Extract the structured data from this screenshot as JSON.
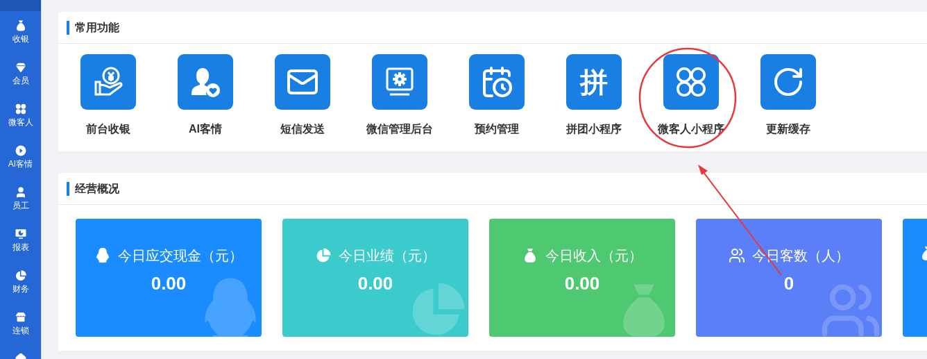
{
  "sidebar": {
    "items": [
      {
        "label": "收银"
      },
      {
        "label": "会员"
      },
      {
        "label": "微客人"
      },
      {
        "label": "AI客情"
      },
      {
        "label": "员工"
      },
      {
        "label": "报表"
      },
      {
        "label": "财务"
      },
      {
        "label": "连锁"
      }
    ]
  },
  "shortcuts": {
    "title": "常用功能",
    "items": [
      {
        "label": "前台收银"
      },
      {
        "label": "AI客情"
      },
      {
        "label": "短信发送"
      },
      {
        "label": "微信管理后台"
      },
      {
        "label": "预约管理"
      },
      {
        "label": "拼团小程序",
        "glyph": "拼"
      },
      {
        "label": "微客人小程序"
      },
      {
        "label": "更新缓存"
      }
    ]
  },
  "overview": {
    "title": "经营概况",
    "cards": [
      {
        "title": "今日应交现金（元）",
        "value": "0.00",
        "color": "#1a8cff"
      },
      {
        "title": "今日业绩（元）",
        "value": "0.00",
        "color": "#3ccbcd"
      },
      {
        "title": "今日收入（元）",
        "value": "0.00",
        "color": "#4ec972"
      },
      {
        "title": "今日客数（人）",
        "value": "0",
        "color": "#5a7ff7"
      },
      {
        "color": "#1a8cff"
      }
    ]
  }
}
